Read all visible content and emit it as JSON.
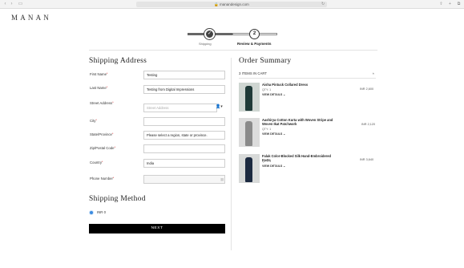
{
  "browser": {
    "url": "manandesign.com",
    "back_icon": "chevron-left-icon",
    "forward_icon": "chevron-right-icon"
  },
  "brand": {
    "logo": "MANAN"
  },
  "progress": {
    "step1_label": "Shipping",
    "step2_label": "Review & Payments",
    "step2_number": "2",
    "step1_icon": "check-icon"
  },
  "shipping": {
    "heading": "Shipping Address",
    "fields": {
      "first_name": {
        "label": "First Name",
        "value": "Testing"
      },
      "last_name": {
        "label": "Last Name",
        "value": "Testing from Digital Impressions"
      },
      "street": {
        "label": "Street Address",
        "placeholder": "Street Address"
      },
      "city": {
        "label": "City",
        "value": ""
      },
      "state": {
        "label": "State/Province",
        "value": "Please select a region, state or province."
      },
      "postal": {
        "label": "Zip/Postal Code",
        "value": ""
      },
      "country": {
        "label": "Country",
        "value": "India"
      },
      "phone": {
        "label": "Phone Number",
        "value": ""
      }
    },
    "required_mark": "*"
  },
  "shipping_method": {
    "heading": "Shipping Method",
    "option_label": "INR 0"
  },
  "actions": {
    "next_label": "NEXT"
  },
  "order_summary": {
    "heading": "Order Summary",
    "items_in_cart": "3 ITEMS IN CART",
    "items": [
      {
        "name": "Aisha Pintuck Collared Dress",
        "qty": "QTY: 1",
        "view": "VIEW DETAILS",
        "price": "INR 2,600",
        "color": "#1f3a38",
        "bg": "#cfd6d2"
      },
      {
        "name": "Aashirya Cotton Kurta with Woven Stripe and Woven Ikat Patchwork",
        "qty": "QTY: 1",
        "view": "VIEW DETAILS",
        "price": "INR 2,120",
        "color": "#8a8a8a",
        "bg": "#dcdcdc"
      },
      {
        "name": "Falak Color-Blocked Silk Hand-Embroidered Kurta",
        "qty": "QTY: 1",
        "view": "VIEW DETAILS",
        "price": "INR 3,640",
        "color": "#1c2a40",
        "bg": "#d8dad9"
      }
    ]
  },
  "colors": {
    "button_bg": "#000000",
    "radio_selected": "#3b8be0",
    "required": "#cc0000"
  }
}
